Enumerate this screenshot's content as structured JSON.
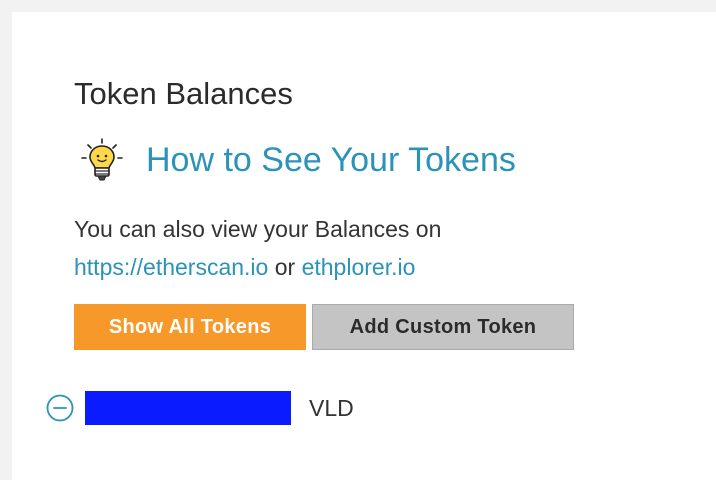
{
  "panel": {
    "title": "Token Balances",
    "help": {
      "icon": "lightbulb-icon",
      "link_text": "How to See Your Tokens"
    },
    "description": {
      "text_before": "You can also view your Balances on",
      "link1": "https://etherscan.io",
      "separator": " or ",
      "link2": "ethplorer.io"
    },
    "buttons": {
      "show_all": "Show All Tokens",
      "add_custom": "Add Custom Token"
    },
    "tokens": [
      {
        "icon": "remove-circle-icon",
        "balance": "",
        "symbol": "VLD"
      }
    ]
  },
  "colors": {
    "link": "#2b93b8",
    "primary_button": "#f7982a",
    "secondary_button": "#c4c4c4",
    "redaction": "#0a1cff"
  }
}
